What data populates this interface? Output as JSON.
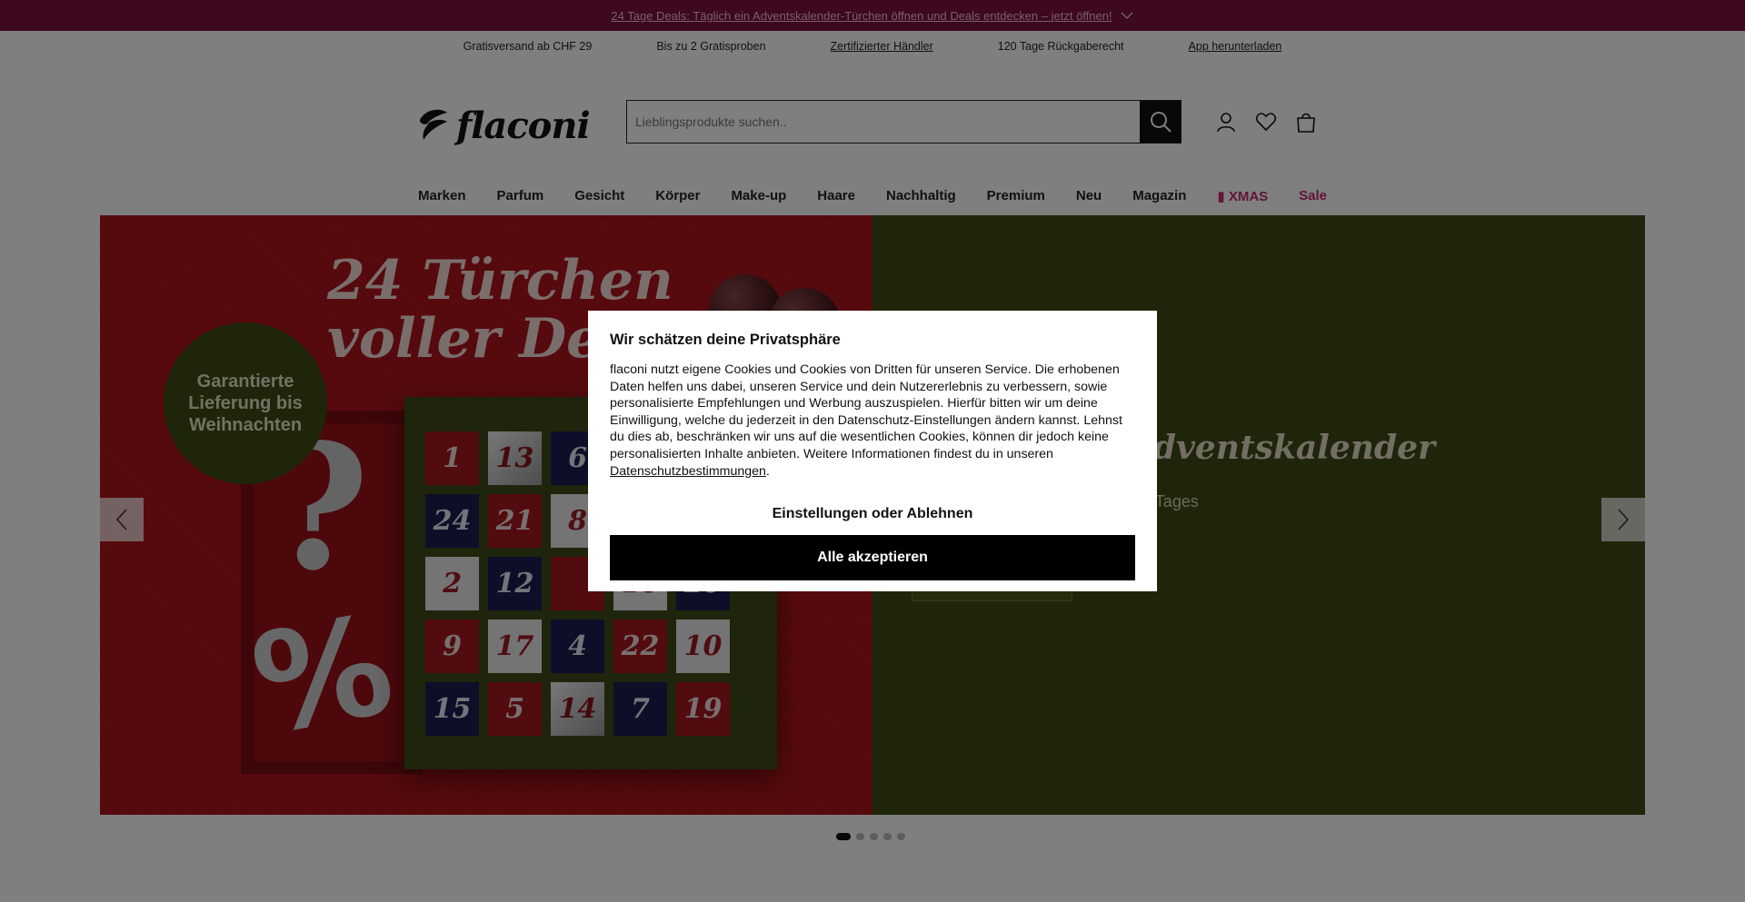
{
  "promo_bar": {
    "text": "24 Tage Deals: Täglich ein Adventskalender-Türchen öffnen und Deals entdecken – jetzt öffnen!",
    "icon": "chevron-down-icon"
  },
  "usp_bar": {
    "items": [
      "Gratisversand ab CHF 29",
      "Bis zu 2 Gratisproben",
      "Zertifizierter Händler",
      "120 Tage Rückgaberecht",
      "App herunterladen"
    ]
  },
  "header": {
    "logo_text": "flaconi",
    "search_placeholder": "Lieblingsprodukte suchen..",
    "icons": [
      "account-icon",
      "wishlist-heart-icon",
      "shopping-bag-icon"
    ]
  },
  "nav": {
    "items": [
      "Marken",
      "Parfum",
      "Gesicht",
      "Körper",
      "Make-up",
      "Haare",
      "Nachhaltig",
      "Premium",
      "Neu",
      "Magazin",
      "XMAS",
      "Sale"
    ]
  },
  "hero": {
    "title": "24 Türchen voller Deals",
    "badge": "Garantierte Lieferung bis Weihnachten",
    "calendar_numbers": [
      "1",
      "13",
      "6",
      "",
      "",
      "24",
      "21",
      "8",
      "",
      "",
      "2",
      "12",
      "",
      "16",
      "20",
      "9",
      "17",
      "4",
      "22",
      "10",
      "15",
      "5",
      "14",
      "7",
      "19"
    ],
    "right_heading": "Flaconi Adventskalender",
    "right_sub": "Entdecke den Deal des Tages",
    "slides_count": 5,
    "active_slide": 1
  },
  "cookie_modal": {
    "title": "Wir schätzen deine Privatsphäre",
    "body": "flaconi nutzt eigene Cookies und Cookies von Dritten für unseren Service. Die erhobenen Daten helfen uns dabei, unseren Service und dein Nutzererlebnis zu verbessern, sowie personalisierte Empfehlungen und Werbung auszuspielen. Hierfür bitten wir um deine Einwilligung, welche du jederzeit in den Datenschutz-Einstellungen ändern kannst. Lehnst du dies ab, beschränken wir uns auf die wesentlichen Cookies, können dir jedoch keine personalisierten Inhalte anbieten. Weitere Informationen findest du in unseren ",
    "link_text": "Datenschutzbestimmungen",
    "body_end": ".",
    "settings_button": "Einstellungen oder Ablehnen",
    "accept_button": "Alle akzeptieren"
  },
  "colors": {
    "promo_bg": "#7a1140",
    "accent_pink": "#c4286b",
    "hero_red": "#b3151c",
    "hero_olive": "#3c4a14"
  }
}
